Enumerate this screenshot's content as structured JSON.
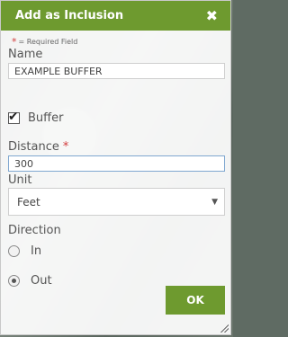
{
  "dialog": {
    "title": "Add as Inclusion",
    "close_glyph": "✖",
    "required_note": "= Required Field",
    "required_glyph": "*",
    "name": {
      "label": "Name",
      "value": "EXAMPLE BUFFER"
    },
    "buffer": {
      "label": "Buffer",
      "checked": true
    },
    "distance": {
      "label": "Distance",
      "value": "300"
    },
    "unit": {
      "label": "Unit",
      "selected": "Feet"
    },
    "direction": {
      "label": "Direction",
      "options": [
        {
          "label": "In",
          "selected": false
        },
        {
          "label": "Out",
          "selected": true
        }
      ]
    },
    "ok_label": "OK"
  },
  "colors": {
    "accent": "#6e9a2f",
    "required": "#d23b3b"
  }
}
